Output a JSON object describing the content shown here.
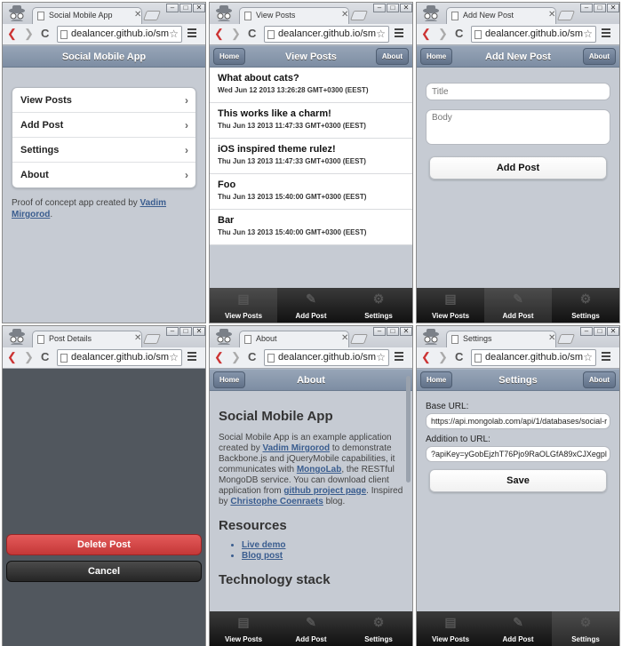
{
  "url": "dealancer.github.io/sma",
  "nav_back": "❮",
  "nav_fwd": "❯",
  "reload": "C",
  "star": "☆",
  "chevron": "›",
  "icons": {
    "view_posts": "list-icon",
    "add_post": "pencil-icon",
    "settings": "gear-icon"
  },
  "windows": [
    {
      "tab_title": "Social Mobile App",
      "header": "Social Mobile App",
      "menu": [
        "View Posts",
        "Add Post",
        "Settings",
        "About"
      ],
      "proof_text": "Proof of concept app created by ",
      "proof_link": "Vadim Mirgorod",
      "proof_end": "."
    },
    {
      "tab_title": "View Posts",
      "header": "View Posts",
      "home": "Home",
      "about": "About",
      "posts": [
        {
          "title": "What about cats?",
          "date": "Wed Jun 12 2013 13:26:28 GMT+0300 (EEST)"
        },
        {
          "title": "This works like a charm!",
          "date": "Thu Jun 13 2013 11:47:33 GMT+0300 (EEST)"
        },
        {
          "title": "iOS inspired theme rulez!",
          "date": "Thu Jun 13 2013 11:47:33 GMT+0300 (EEST)"
        },
        {
          "title": "Foo",
          "date": "Thu Jun 13 2013 15:40:00 GMT+0300 (EEST)"
        },
        {
          "title": "Bar",
          "date": "Thu Jun 13 2013 15:40:00 GMT+0300 (EEST)"
        }
      ]
    },
    {
      "tab_title": "Add New Post",
      "header": "Add New Post",
      "home": "Home",
      "about": "About",
      "title_placeholder": "Title",
      "body_placeholder": "Body",
      "submit": "Add Post"
    },
    {
      "tab_title": "Post Details",
      "delete": "Delete Post",
      "cancel": "Cancel"
    },
    {
      "tab_title": "About",
      "header": "About",
      "home": "Home",
      "h_app": "Social Mobile App",
      "p1": "Social Mobile App is an example application created by ",
      "p1_link1": "Vadim Mirgorod",
      "p2": " to demonstrate Backbone.js and jQueryMobile capabilities, it communicates with ",
      "p2_link": "MongoLab",
      "p3": ", the RESTful MongoDB service. You can download client application from ",
      "p3_link": "github project page",
      "p4": ". Inspired by ",
      "p4_link": "Christophe Coenraets",
      "p5": " blog.",
      "h_res": "Resources",
      "resources": [
        "Live demo",
        "Blog post"
      ],
      "h_tech": "Technology stack"
    },
    {
      "tab_title": "Settings",
      "header": "Settings",
      "home": "Home",
      "about": "About",
      "base_label": "Base URL:",
      "base_value": "https://api.mongolab.com/api/1/databases/social-r",
      "add_label": "Addition to URL:",
      "add_value": "?apiKey=yGobEjzhT76Pjo9RaOLGfA89xCJXegpl",
      "save": "Save"
    }
  ],
  "tabbar": {
    "view_posts": "View Posts",
    "add_post": "Add Post",
    "settings": "Settings"
  }
}
